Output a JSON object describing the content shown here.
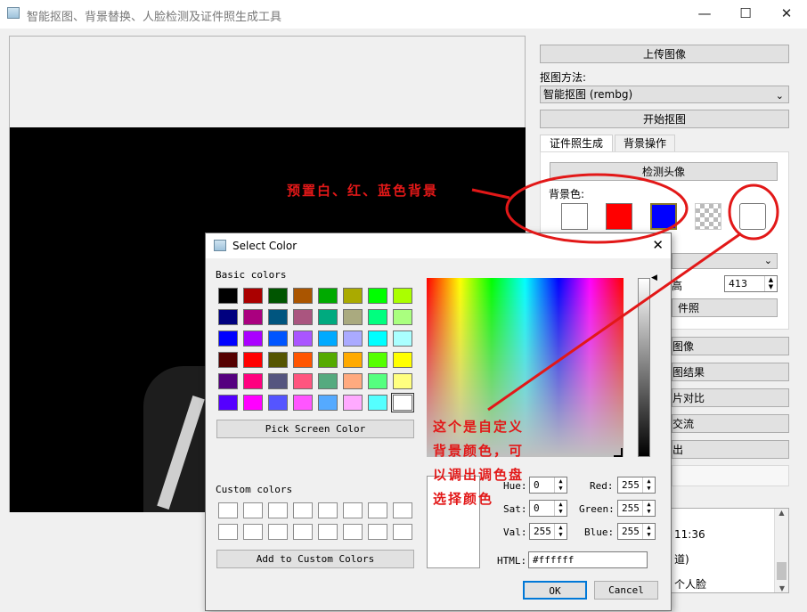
{
  "window": {
    "title": "智能抠图、背景替换、人脸检测及证件照生成工具",
    "minimize": "—",
    "maximize": "☐",
    "close": "✕"
  },
  "right_panel": {
    "upload_btn": "上传图像",
    "method_label": "抠图方法:",
    "method_value": "智能抠图 (rembg)",
    "start_btn": "开始抠图",
    "tabs": [
      "证件照生成",
      "背景操作"
    ],
    "detect_btn": "检测头像",
    "bg_label": "背景色:",
    "bg_colors": {
      "white": "#ffffff",
      "red": "#ff0000",
      "blue": "#0000ff"
    },
    "height_value": "413",
    "height_suffix": "高",
    "gen_btn_partial": "件照",
    "btn_partials": [
      "图像",
      "图结果",
      "片对比",
      "交流",
      "出"
    ],
    "log_lines": [
      "11:36",
      "道)",
      "个人脸"
    ]
  },
  "dialog": {
    "title": "Select Color",
    "close": "✕",
    "basic_colors_label": "Basic colors",
    "basic_colors": [
      "#000000",
      "#aa0000",
      "#005500",
      "#aa5500",
      "#00aa00",
      "#aaaa00",
      "#00ff00",
      "#aaff00",
      "#00007f",
      "#aa007f",
      "#00557f",
      "#aa557f",
      "#00aa7f",
      "#aaaa7f",
      "#00ff7f",
      "#aaff7f",
      "#0000ff",
      "#aa00ff",
      "#0055ff",
      "#aa55ff",
      "#00aaff",
      "#aaaaff",
      "#00ffff",
      "#aaffff",
      "#550000",
      "#ff0000",
      "#555500",
      "#ff5500",
      "#55aa00",
      "#ffaa00",
      "#55ff00",
      "#ffff00",
      "#55007f",
      "#ff007f",
      "#55557f",
      "#ff557f",
      "#55aa7f",
      "#ffaa7f",
      "#55ff7f",
      "#ffff7f",
      "#5500ff",
      "#ff00ff",
      "#5555ff",
      "#ff55ff",
      "#55aaff",
      "#ffaaff",
      "#55ffff",
      "#ffffff"
    ],
    "pick_screen_btn": "Pick Screen Color",
    "custom_colors_label": "Custom colors",
    "add_custom_btn": "Add to Custom Colors",
    "hue_label": "Hue:",
    "hue": "0",
    "sat_label": "Sat:",
    "sat": "0",
    "val_label": "Val:",
    "val": "255",
    "red_label": "Red:",
    "red": "255",
    "green_label": "Green:",
    "green": "255",
    "blue_label": "Blue:",
    "blue": "255",
    "html_label": "HTML:",
    "html": "#ffffff",
    "ok_btn": "OK",
    "cancel_btn": "Cancel"
  },
  "annotations": {
    "preset": "预置白、红、蓝色背景",
    "custom_line1": "这个是自定义",
    "custom_line2": "背景颜色，可",
    "custom_line3": "以调出调色盘",
    "custom_line4": "选择颜色",
    "color": "#e21818"
  }
}
